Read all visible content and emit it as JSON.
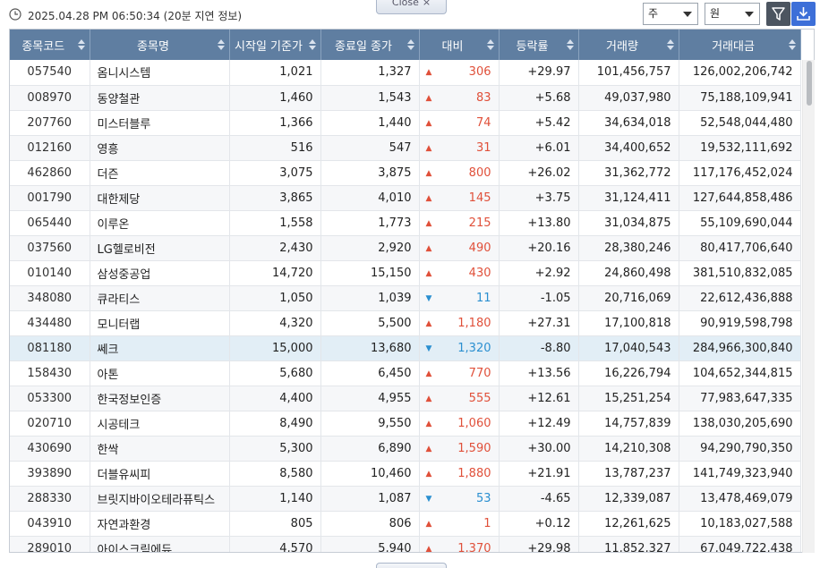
{
  "header": {
    "timestamp": "2025.04.28 PM 06:50:34",
    "delay_note": "(20분 지연 정보)",
    "close_label": "Close",
    "close_glyph": "×"
  },
  "controls": {
    "unit_select": "주",
    "currency_select": "원",
    "filter_icon": "filter-icon",
    "download_icon": "download-icon"
  },
  "colors": {
    "header_bg": "#5f7ea1",
    "up": "#e0503a",
    "down": "#2a8fd0",
    "selected_row": "#e2eef6",
    "download_btn": "#3d6fd8"
  },
  "table": {
    "columns": [
      "종목코드",
      "종목명",
      "시작일 기준가",
      "종료일 종가",
      "대비",
      "등락률",
      "거래량",
      "거래대금"
    ],
    "selected_row_index": 11,
    "rows": [
      {
        "code": "057540",
        "name": "옴니시스템",
        "base": "1,021",
        "close": "1,327",
        "dir": "up",
        "arrow": "▲",
        "change": "306",
        "rate": "+29.97",
        "volume": "101,456,757",
        "amount": "126,002,206,742"
      },
      {
        "code": "008970",
        "name": "동양철관",
        "base": "1,460",
        "close": "1,543",
        "dir": "up",
        "arrow": "▲",
        "change": "83",
        "rate": "+5.68",
        "volume": "49,037,980",
        "amount": "75,188,109,941"
      },
      {
        "code": "207760",
        "name": "미스터블루",
        "base": "1,366",
        "close": "1,440",
        "dir": "up",
        "arrow": "▲",
        "change": "74",
        "rate": "+5.42",
        "volume": "34,634,018",
        "amount": "52,548,044,480"
      },
      {
        "code": "012160",
        "name": "영흥",
        "base": "516",
        "close": "547",
        "dir": "up",
        "arrow": "▲",
        "change": "31",
        "rate": "+6.01",
        "volume": "34,400,652",
        "amount": "19,532,111,692"
      },
      {
        "code": "462860",
        "name": "더즌",
        "base": "3,075",
        "close": "3,875",
        "dir": "up",
        "arrow": "▲",
        "change": "800",
        "rate": "+26.02",
        "volume": "31,362,772",
        "amount": "117,176,452,024"
      },
      {
        "code": "001790",
        "name": "대한제당",
        "base": "3,865",
        "close": "4,010",
        "dir": "up",
        "arrow": "▲",
        "change": "145",
        "rate": "+3.75",
        "volume": "31,124,411",
        "amount": "127,644,858,486"
      },
      {
        "code": "065440",
        "name": "이루온",
        "base": "1,558",
        "close": "1,773",
        "dir": "up",
        "arrow": "▲",
        "change": "215",
        "rate": "+13.80",
        "volume": "31,034,875",
        "amount": "55,109,690,044"
      },
      {
        "code": "037560",
        "name": "LG헬로비전",
        "base": "2,430",
        "close": "2,920",
        "dir": "up",
        "arrow": "▲",
        "change": "490",
        "rate": "+20.16",
        "volume": "28,380,246",
        "amount": "80,417,706,640"
      },
      {
        "code": "010140",
        "name": "삼성중공업",
        "base": "14,720",
        "close": "15,150",
        "dir": "up",
        "arrow": "▲",
        "change": "430",
        "rate": "+2.92",
        "volume": "24,860,498",
        "amount": "381,510,832,085"
      },
      {
        "code": "348080",
        "name": "큐라티스",
        "base": "1,050",
        "close": "1,039",
        "dir": "down",
        "arrow": "▼",
        "change": "11",
        "rate": "-1.05",
        "volume": "20,716,069",
        "amount": "22,612,436,888"
      },
      {
        "code": "434480",
        "name": "모니터랩",
        "base": "4,320",
        "close": "5,500",
        "dir": "up",
        "arrow": "▲",
        "change": "1,180",
        "rate": "+27.31",
        "volume": "17,100,818",
        "amount": "90,919,598,798"
      },
      {
        "code": "081180",
        "name": "쎄크",
        "base": "15,000",
        "close": "13,680",
        "dir": "down",
        "arrow": "▼",
        "change": "1,320",
        "rate": "-8.80",
        "volume": "17,040,543",
        "amount": "284,966,300,840"
      },
      {
        "code": "158430",
        "name": "아톤",
        "base": "5,680",
        "close": "6,450",
        "dir": "up",
        "arrow": "▲",
        "change": "770",
        "rate": "+13.56",
        "volume": "16,226,794",
        "amount": "104,652,344,815"
      },
      {
        "code": "053300",
        "name": "한국정보인증",
        "base": "4,400",
        "close": "4,955",
        "dir": "up",
        "arrow": "▲",
        "change": "555",
        "rate": "+12.61",
        "volume": "15,251,254",
        "amount": "77,983,647,335"
      },
      {
        "code": "020710",
        "name": "시공테크",
        "base": "8,490",
        "close": "9,550",
        "dir": "up",
        "arrow": "▲",
        "change": "1,060",
        "rate": "+12.49",
        "volume": "14,757,839",
        "amount": "138,030,205,690"
      },
      {
        "code": "430690",
        "name": "한싹",
        "base": "5,300",
        "close": "6,890",
        "dir": "up",
        "arrow": "▲",
        "change": "1,590",
        "rate": "+30.00",
        "volume": "14,210,308",
        "amount": "94,290,790,350"
      },
      {
        "code": "393890",
        "name": "더블유씨피",
        "base": "8,580",
        "close": "10,460",
        "dir": "up",
        "arrow": "▲",
        "change": "1,880",
        "rate": "+21.91",
        "volume": "13,787,237",
        "amount": "141,749,323,940"
      },
      {
        "code": "288330",
        "name": "브릿지바이오테라퓨틱스",
        "base": "1,140",
        "close": "1,087",
        "dir": "down",
        "arrow": "▼",
        "change": "53",
        "rate": "-4.65",
        "volume": "12,339,087",
        "amount": "13,478,469,079"
      },
      {
        "code": "043910",
        "name": "자연과환경",
        "base": "805",
        "close": "806",
        "dir": "up",
        "arrow": "▲",
        "change": "1",
        "rate": "+0.12",
        "volume": "12,261,625",
        "amount": "10,183,027,588"
      },
      {
        "code": "289010",
        "name": "아이스크림에듀",
        "base": "4,570",
        "close": "5,940",
        "dir": "up",
        "arrow": "▲",
        "change": "1,370",
        "rate": "+29.98",
        "volume": "11,852,327",
        "amount": "67,049,722,438"
      }
    ]
  }
}
